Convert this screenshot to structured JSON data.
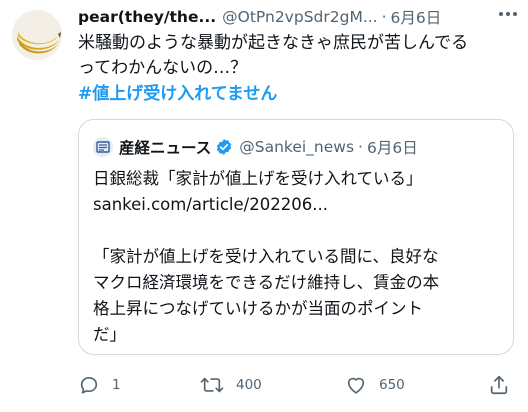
{
  "tweet": {
    "display_name": "pear(they/the...",
    "handle": "@OtPn2vpSdr2gM...",
    "separator": "·",
    "date": "6月6日",
    "text_lines": [
      "米騒動のような暴動が起きなきゃ庶民が苦しんでる",
      "ってわかんないの…？"
    ],
    "hashtag": "#値上げ受け入れてません"
  },
  "quote": {
    "display_name": "産経ニュース",
    "handle": "@Sankei_news",
    "separator": "·",
    "date": "6月6日",
    "body_lines": [
      "日銀総裁「家計が値上げを受け入れている」",
      "sankei.com/article/202206...",
      "",
      "「家計が値上げを受け入れている間に、良好な",
      "マクロ経済環境をできるだけ維持し、賃金の本",
      "格上昇につなげていけるかが当面のポイント",
      "だ」"
    ]
  },
  "actions": {
    "reply_count": "1",
    "retweet_count": "400",
    "like_count": "650"
  },
  "colors": {
    "text": "#0f1419",
    "secondary": "#536471",
    "link": "#1d9bf0",
    "border": "#cfd9de",
    "verified": "#1d9bf0"
  }
}
